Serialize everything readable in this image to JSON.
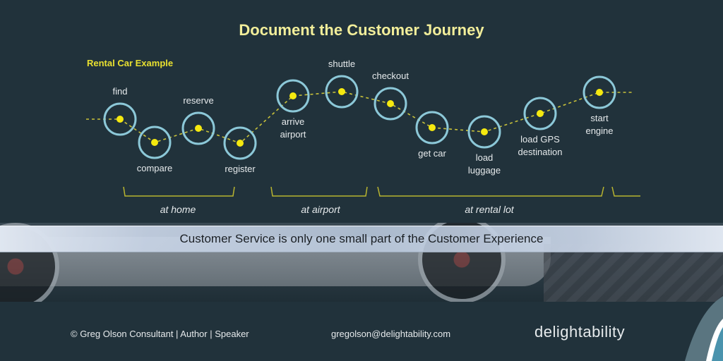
{
  "title": "Document the Customer Journey",
  "subtitle": "Rental Car Example",
  "journey": {
    "steps": [
      {
        "id": "find",
        "label": "find",
        "label_position": "above"
      },
      {
        "id": "compare",
        "label": "compare",
        "label_position": "below"
      },
      {
        "id": "reserve",
        "label": "reserve",
        "label_position": "above"
      },
      {
        "id": "register",
        "label": "register",
        "label_position": "below"
      },
      {
        "id": "arrive-airport",
        "label": "arrive airport",
        "label_lines": [
          "arrive",
          "airport"
        ],
        "label_position": "below"
      },
      {
        "id": "shuttle",
        "label": "shuttle",
        "label_position": "above"
      },
      {
        "id": "checkout",
        "label": "checkout",
        "label_position": "above"
      },
      {
        "id": "get-car",
        "label": "get car",
        "label_position": "below"
      },
      {
        "id": "load-luggage",
        "label": "load luggage",
        "label_lines": [
          "load",
          "luggage"
        ],
        "label_position": "below"
      },
      {
        "id": "load-gps",
        "label": "load GPS destination",
        "label_lines": [
          "load GPS",
          "destination"
        ],
        "label_position": "below"
      },
      {
        "id": "start-engine",
        "label": "start engine",
        "label_lines": [
          "start",
          "engine"
        ],
        "label_position": "below"
      }
    ],
    "phases": [
      {
        "label": "at home"
      },
      {
        "label": "at airport"
      },
      {
        "label": "at rental lot"
      }
    ]
  },
  "banner": "Customer Service is only one small part of the Customer Experience",
  "footer": {
    "credit": "©  Greg Olson  Consultant | Author | Speaker",
    "email": "gregolson@delightability.com",
    "logo": "delightability"
  },
  "colors": {
    "background": "#21323b",
    "title": "#f2ee9a",
    "subtitle": "#e8e030",
    "node_ring": "#8cc8d8",
    "node_dot": "#f5e90f",
    "path": "#c9c23a",
    "bracket": "#b8b430",
    "corner_teal": "#4a93ad",
    "corner_gray": "#5a7580"
  }
}
